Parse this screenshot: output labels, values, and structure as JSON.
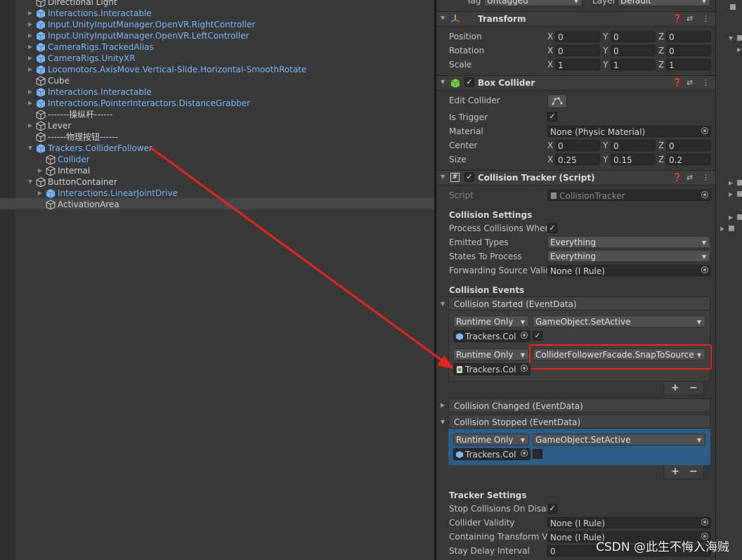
{
  "hierarchy": {
    "items": [
      {
        "label": "Directional Light",
        "type": "plain",
        "indent": 1,
        "fold": false
      },
      {
        "label": "Interactions.Interactable",
        "type": "prefab",
        "indent": 1,
        "fold": true
      },
      {
        "label": "Input.UnityInputManager.OpenVR.RightController",
        "type": "prefab",
        "indent": 1,
        "fold": true
      },
      {
        "label": "Input.UnityInputManager.OpenVR.LeftController",
        "type": "prefab",
        "indent": 1,
        "fold": true
      },
      {
        "label": "CameraRigs.TrackedAlias",
        "type": "prefab",
        "indent": 1,
        "fold": true
      },
      {
        "label": "CameraRigs.UnityXR",
        "type": "prefab",
        "indent": 1,
        "fold": true
      },
      {
        "label": "Locomotors.AxisMove.Vertical-Slide.Horizontal-SmoothRotate",
        "type": "prefab",
        "indent": 1,
        "fold": true
      },
      {
        "label": "Cube",
        "type": "plain",
        "indent": 1,
        "fold": false
      },
      {
        "label": "Interactions.Interactable",
        "type": "prefab",
        "indent": 1,
        "fold": true
      },
      {
        "label": "Interactions.PointerInteractors.DistanceGrabber",
        "type": "prefab",
        "indent": 1,
        "fold": true
      },
      {
        "label": "-------操纵杆------",
        "type": "plain",
        "indent": 1,
        "fold": false
      },
      {
        "label": "Lever",
        "type": "plain",
        "indent": 1,
        "fold": true
      },
      {
        "label": "------物理按钮------",
        "type": "plain",
        "indent": 1,
        "fold": false
      },
      {
        "label": "Trackers.ColliderFollower",
        "type": "prefab",
        "indent": 1,
        "fold": "open"
      },
      {
        "label": "Collider",
        "type": "prefab-child",
        "indent": 2,
        "fold": false
      },
      {
        "label": "Internal",
        "type": "plain",
        "indent": 2,
        "fold": true
      },
      {
        "label": "ButtonContainer",
        "type": "plain",
        "indent": 1,
        "fold": "open"
      },
      {
        "label": "Interactions.LinearJointDrive",
        "type": "prefab",
        "indent": 2,
        "fold": true
      },
      {
        "label": "ActivationArea",
        "type": "plain",
        "indent": 2,
        "fold": false,
        "selected": true
      }
    ]
  },
  "inspector": {
    "top": {
      "tag_label": "Tag",
      "tag_value": "Untagged",
      "layer_label": "Layer",
      "layer_value": "Default"
    },
    "transform": {
      "title": "Transform",
      "rows": [
        {
          "label": "Position",
          "x": "0",
          "y": "0",
          "z": "0"
        },
        {
          "label": "Rotation",
          "x": "0",
          "y": "0",
          "z": "0"
        },
        {
          "label": "Scale",
          "x": "1",
          "y": "1",
          "z": "1"
        }
      ]
    },
    "box_collider": {
      "title": "Box Collider",
      "edit_collider": "Edit Collider",
      "is_trigger": "Is Trigger",
      "material_label": "Material",
      "material_value": "None (Physic Material)",
      "center_label": "Center",
      "center": {
        "x": "0",
        "y": "0",
        "z": "0"
      },
      "size_label": "Size",
      "size": {
        "x": "0.25",
        "y": "0.15",
        "z": "0.2"
      }
    },
    "collision_tracker": {
      "title": "Collision Tracker (Script)",
      "script_label": "Script",
      "script_value": "CollisionTracker",
      "settings_header": "Collision Settings",
      "process_label": "Process Collisions When",
      "emitted_label": "Emitted Types",
      "emitted_value": "Everything",
      "states_label": "States To Process",
      "states_value": "Everything",
      "forwarding_label": "Forwarding Source Valid",
      "forwarding_value": "None (I Rule)",
      "events_header": "Collision Events",
      "started": {
        "title": "Collision Started (EventData)",
        "e1": {
          "mode": "Runtime Only",
          "func": "GameObject.SetActive",
          "obj": "Trackers.Col"
        },
        "e2": {
          "mode": "Runtime Only",
          "func": "ColliderFollowerFacade.SnapToSource",
          "obj": "Trackers.Col"
        }
      },
      "changed_title": "Collision Changed (EventData)",
      "stopped": {
        "title": "Collision Stopped (EventData)",
        "e1": {
          "mode": "Runtime Only",
          "func": "GameObject.SetActive",
          "obj": "Trackers.Col"
        }
      },
      "plus": "+",
      "minus": "−",
      "tracker_header": "Tracker Settings",
      "stop_label": "Stop Collisions On Disab",
      "validity_label": "Collider Validity",
      "validity_value": "None (I Rule)",
      "containing_label": "Containing Transform Va",
      "containing_value": "None (I Rule)",
      "stay_label": "Stay Delay Interval",
      "stay_value": "0"
    }
  },
  "watermark": "CSDN @此生不悔入海贼",
  "colors": {
    "prefab": "#7bb6f5",
    "highlight_blue": "#2c5d87",
    "annotation_red": "#e8231e"
  }
}
